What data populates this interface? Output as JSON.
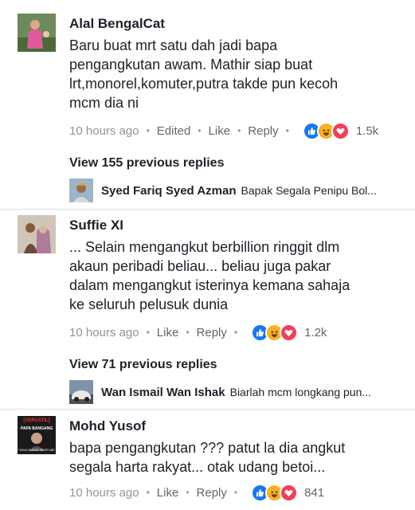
{
  "comments": [
    {
      "author": "Alal BengalCat",
      "lines": [
        "Baru buat mrt satu dah jadi bapa",
        "pengangkutan awam. Mathir siap buat",
        "lrt,monorel,komuter,putra takde pun kecoh",
        "mcm dia ni"
      ],
      "time": "10 hours ago",
      "edited": "Edited",
      "like": "Like",
      "reply": "Reply",
      "reaction_count": "1.5k",
      "view_replies": "View 155 previous replies",
      "latest_reply": {
        "author": "Syed Fariq Syed Azman",
        "text": "Bapak Segala Penipu Bol..."
      }
    },
    {
      "author": "Suffie XI",
      "lines": [
        "... Selain mengangkut berbillion ringgit dlm",
        "akaun peribadi beliau... beliau juga pakar",
        "dalam mengangkut isterinya kemana sahaja",
        "ke seluruh pelusuk dunia"
      ],
      "time": "10 hours ago",
      "like": "Like",
      "reply": "Reply",
      "reaction_count": "1.2k",
      "view_replies": "View 71 previous replies",
      "latest_reply": {
        "author": "Wan Ismail Wan Ishak",
        "text": "Biarlah mcm longkang pun..."
      }
    },
    {
      "author": "Mohd Yusof",
      "lines": [
        "bapa pengangkutan ??? patut la dia angkut",
        "segala harta rakyat... otak udang betoi..."
      ],
      "time": "10 hours ago",
      "like": "Like",
      "reply": "Reply",
      "reaction_count": "841",
      "avatar_caption_top": "[VERSATIL]",
      "avatar_caption_mid": "PAPA BANGANG",
      "avatar_caption_bottom": "\"SAYA SUDAH BERTUBI\""
    }
  ],
  "reactions": [
    "like-icon",
    "haha-icon",
    "love-icon"
  ],
  "colors": {
    "like": "#1877f2",
    "haha": "#f7b125",
    "love": "#f33e58",
    "meta": "#90949c"
  }
}
